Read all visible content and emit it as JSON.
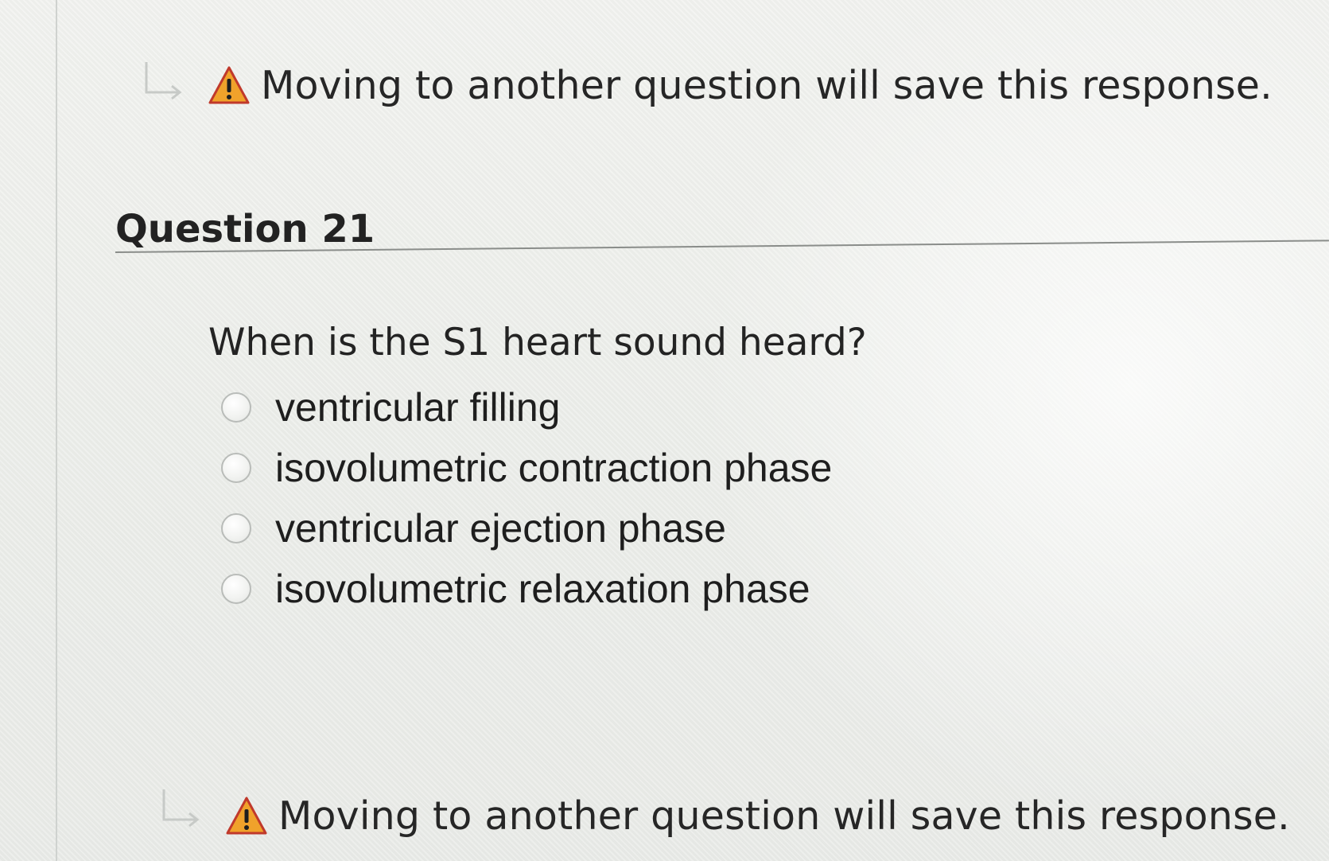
{
  "notice_top": {
    "text": "Moving to another question will save this response.",
    "icon": "warning-icon"
  },
  "question": {
    "title": "Question 21",
    "prompt": "When is the S1 heart sound heard?",
    "options": [
      {
        "label": "ventricular filling",
        "selected": false
      },
      {
        "label": "isovolumetric contraction phase",
        "selected": false
      },
      {
        "label": "ventricular ejection phase",
        "selected": false
      },
      {
        "label": "isovolumetric relaxation phase",
        "selected": false
      }
    ]
  },
  "notice_bottom": {
    "text": "Moving to another question will save this response.",
    "icon": "warning-icon"
  },
  "colors": {
    "warning_fill": "#f0a22b",
    "warning_stroke": "#c0392b",
    "background": "#eef0ed",
    "rule": "#8a8d8a"
  }
}
